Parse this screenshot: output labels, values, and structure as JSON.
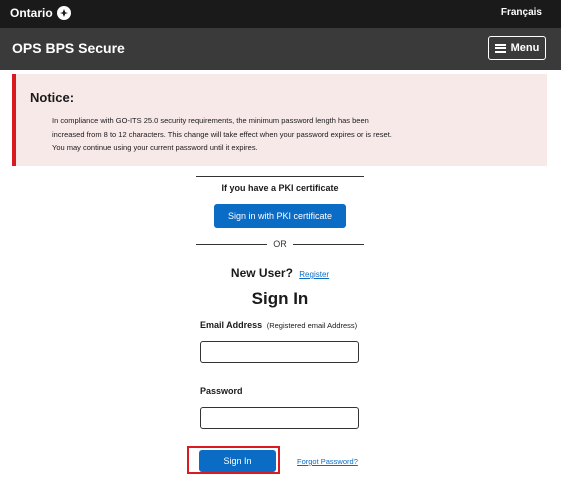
{
  "topbar": {
    "brand": "Ontario",
    "language_link": "Français"
  },
  "appbar": {
    "title": "OPS BPS Secure",
    "menu_label": "Menu"
  },
  "notice": {
    "title": "Notice:",
    "lines": [
      "In compliance with GO-ITS 25.0 security requirements, the minimum password length has been",
      "increased from 8 to 12 characters. This change will take effect when your password expires or is reset.",
      "You may continue using your current password until it expires."
    ]
  },
  "pki": {
    "label": "If you have a PKI certificate",
    "button": "Sign in with PKI certificate"
  },
  "or_text": "OR",
  "new_user": {
    "label": "New User?",
    "link": "Register"
  },
  "signin": {
    "heading": "Sign In",
    "email_label": "Email Address",
    "email_note": "(Registered email Address)",
    "email_value": "",
    "password_label": "Password",
    "password_value": "",
    "button": "Sign In",
    "forgot_link": "Forgot Password?"
  },
  "colors": {
    "topbar_bg": "#1a1a1a",
    "appbar_bg": "#3a3a3a",
    "notice_bg": "#f8e9e9",
    "notice_border": "#d81a21",
    "button_blue": "#0b6cc6",
    "highlight": "#d81a21"
  }
}
